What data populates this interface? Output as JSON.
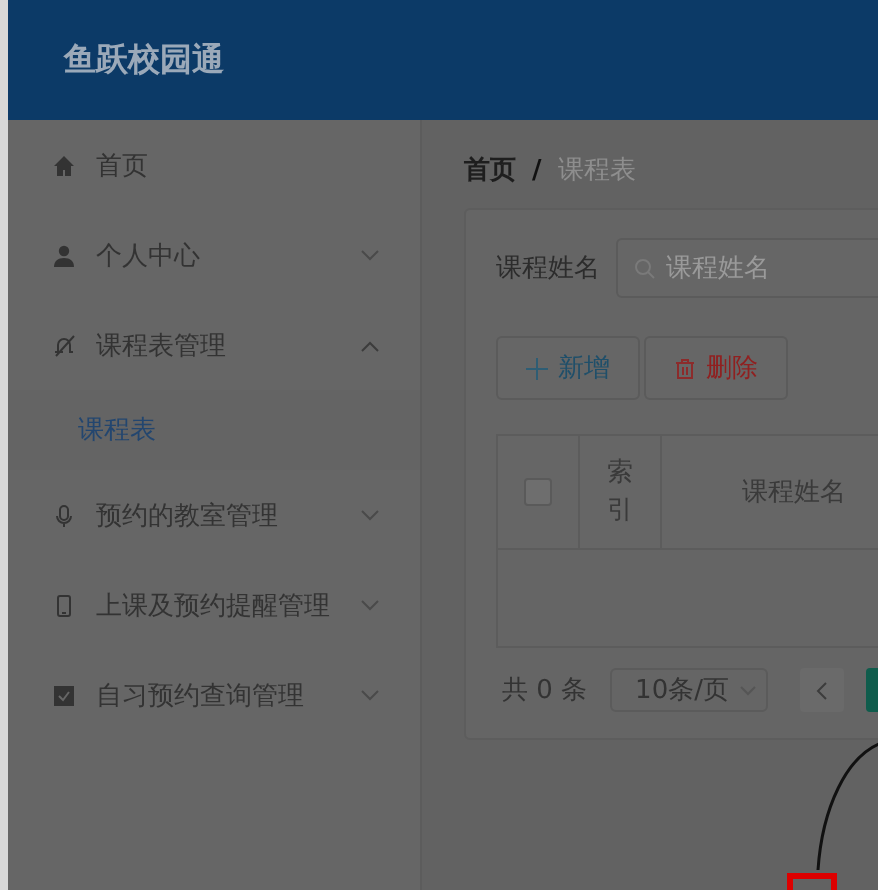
{
  "header": {
    "title": "鱼跃校园通"
  },
  "sidebar": {
    "items": [
      {
        "label": "首页",
        "kind": "link"
      },
      {
        "label": "个人中心",
        "kind": "menu",
        "expanded": false
      },
      {
        "label": "课程表管理",
        "kind": "menu",
        "expanded": true,
        "children": [
          {
            "label": "课程表",
            "selected": true
          }
        ]
      },
      {
        "label": "预约的教室管理",
        "kind": "menu",
        "expanded": false
      },
      {
        "label": "上课及预约提醒管理",
        "kind": "menu",
        "expanded": false
      },
      {
        "label": "自习预约查询管理",
        "kind": "menu",
        "expanded": false
      }
    ]
  },
  "breadcrumb": {
    "items": [
      "首页",
      "课程表"
    ],
    "separator": "/"
  },
  "search": {
    "label": "课程姓名",
    "placeholder": "课程姓名"
  },
  "toolbar": [
    {
      "label": "新增",
      "kind": "add"
    },
    {
      "label": "删除",
      "kind": "delete"
    }
  ],
  "table": {
    "select_all": {
      "checked": false
    },
    "columns": [
      "索引",
      "课程姓名"
    ]
  },
  "pagination": {
    "total": "共 0 条",
    "page_size": "10条/页"
  }
}
